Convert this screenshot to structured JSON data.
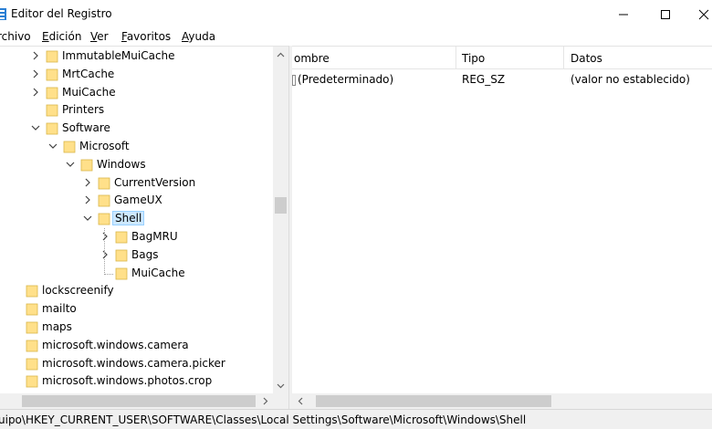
{
  "window": {
    "title": "Editor del Registro",
    "controls": {
      "minimize": "minimize-icon",
      "maximize": "maximize-icon",
      "close": "close-icon"
    }
  },
  "menu": [
    {
      "label": "rchivo"
    },
    {
      "label": "Edición",
      "mnemonic": "E"
    },
    {
      "label": "Ver",
      "mnemonic": "V"
    },
    {
      "label": "Favoritos",
      "mnemonic": "F"
    },
    {
      "label": "Ayuda",
      "mnemonic": "A"
    }
  ],
  "tree": {
    "items": [
      {
        "label": "ImmutableMuiCache",
        "depth": 1,
        "expander": "collapsed"
      },
      {
        "label": "MrtCache",
        "depth": 1,
        "expander": "collapsed"
      },
      {
        "label": "MuiCache",
        "depth": 1,
        "expander": "collapsed"
      },
      {
        "label": "Printers",
        "depth": 1,
        "expander": "none"
      },
      {
        "label": "Software",
        "depth": 1,
        "expander": "expanded"
      },
      {
        "label": "Microsoft",
        "depth": 2,
        "expander": "expanded"
      },
      {
        "label": "Windows",
        "depth": 3,
        "expander": "expanded"
      },
      {
        "label": "CurrentVersion",
        "depth": 4,
        "expander": "collapsed"
      },
      {
        "label": "GameUX",
        "depth": 4,
        "expander": "collapsed"
      },
      {
        "label": "Shell",
        "depth": 4,
        "expander": "expanded",
        "selected": true
      },
      {
        "label": "BagMRU",
        "depth": 5,
        "expander": "collapsed"
      },
      {
        "label": "Bags",
        "depth": 5,
        "expander": "collapsed"
      },
      {
        "label": "MuiCache",
        "depth": 5,
        "expander": "none"
      },
      {
        "label": "lockscreenify",
        "depth": 0,
        "expander": "none"
      },
      {
        "label": "mailto",
        "depth": 0,
        "expander": "none"
      },
      {
        "label": "maps",
        "depth": 0,
        "expander": "none"
      },
      {
        "label": "microsoft.windows.camera",
        "depth": 0,
        "expander": "none"
      },
      {
        "label": "microsoft.windows.camera.picker",
        "depth": 0,
        "expander": "none"
      },
      {
        "label": "microsoft.windows.photos.crop",
        "depth": 0,
        "expander": "none"
      }
    ]
  },
  "list": {
    "columns": [
      "ombre",
      "Tipo",
      "Datos"
    ],
    "rows": [
      {
        "name": "(Predeterminado)",
        "type": "REG_SZ",
        "data": "(valor no establecido)"
      }
    ]
  },
  "status": {
    "path": "uipo\\HKEY_CURRENT_USER\\SOFTWARE\\Classes\\Local Settings\\Software\\Microsoft\\Windows\\Shell"
  },
  "colors": {
    "folder": "#ffe08a",
    "folder_edge": "#d9b64a",
    "selection": "#cce8ff",
    "selection_border": "#99d1ff",
    "app_icon": "#2a7fd4"
  }
}
